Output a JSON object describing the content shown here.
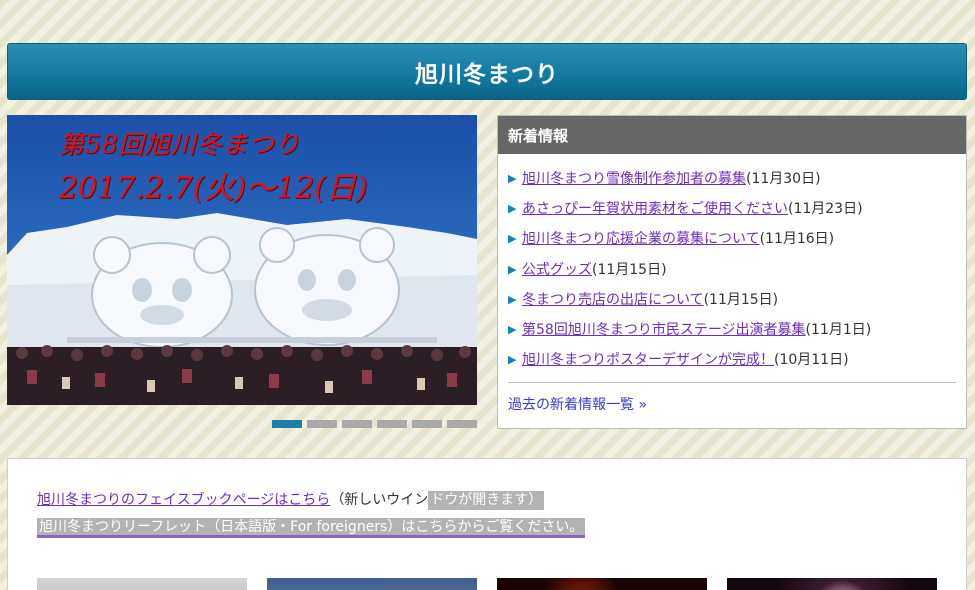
{
  "header": {
    "title": "旭川冬まつり"
  },
  "slideshow": {
    "caption_line1": "第58回旭川冬まつり",
    "caption_line2": "2017.2.7(火)～12(日)",
    "slide_count": 6,
    "active_index": 0
  },
  "news": {
    "heading": "新着情報",
    "items": [
      {
        "link": "旭川冬まつり雪像制作参加者の募集",
        "date": "(11月30日)"
      },
      {
        "link": "あさっぴー年賀状用素材をご使用ください",
        "date": "(11月23日)"
      },
      {
        "link": "旭川冬まつり応援企業の募集について",
        "date": "(11月16日)"
      },
      {
        "link": "公式グッズ",
        "date": "(11月15日)"
      },
      {
        "link": "冬まつり売店の出店について",
        "date": "(11月15日)"
      },
      {
        "link": "第58回旭川冬まつり市民ステージ出演者募集",
        "date": "(11月1日)"
      },
      {
        "link": "旭川冬まつりポスターデザインが完成！",
        "date": "(10月11日)"
      }
    ],
    "past_link": "過去の新着情報一覧 »"
  },
  "bottom": {
    "facebook_link": "旭川冬まつりのフェイスブックページはこちら",
    "facebook_note_plain": "（新しいウイン",
    "facebook_note_highlight": "ドウが開きます）",
    "leaflet_link": "旭川冬まつりリーフレット（日本語版・For foreigners）はこちらからご覧ください。"
  },
  "colors": {
    "title_bar": "#137aa0",
    "news_header": "#666666",
    "link_visited": "#6e2fbd",
    "active_dot": "#1b7fa6",
    "caption_red": "#d8141e"
  },
  "icons": {
    "news_bullet": "triangle-right-icon"
  }
}
